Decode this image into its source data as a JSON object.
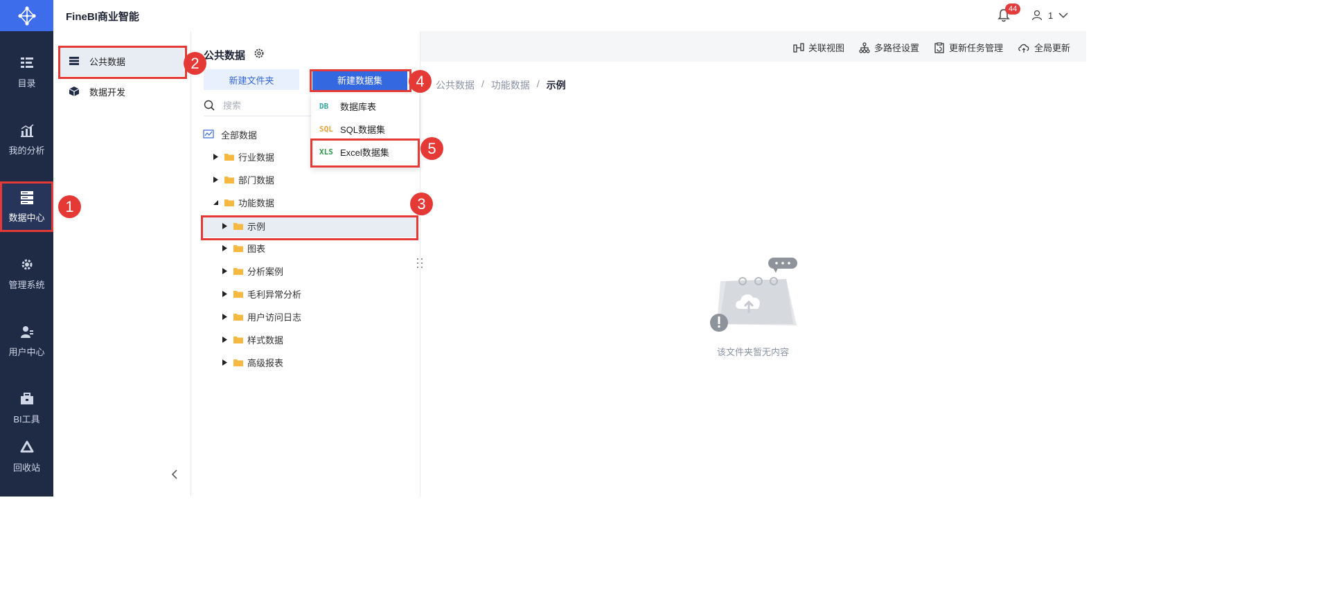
{
  "header": {
    "app_title": "FineBI商业智能",
    "notification_count": "44",
    "user_name": "1"
  },
  "rail": {
    "items": [
      {
        "label": "目录",
        "icon": "catalog-icon"
      },
      {
        "label": "我的分析",
        "icon": "analysis-icon"
      },
      {
        "label": "数据中心",
        "icon": "data-center-icon",
        "active": true
      },
      {
        "label": "管理系统",
        "icon": "gear-icon"
      },
      {
        "label": "用户中心",
        "icon": "user-icon"
      },
      {
        "label": "BI工具",
        "icon": "toolbox-icon"
      },
      {
        "label": "回收站",
        "icon": "recycle-icon"
      }
    ]
  },
  "col2": {
    "items": [
      {
        "label": "公共数据",
        "active": true
      },
      {
        "label": "数据开发"
      }
    ]
  },
  "panel": {
    "title": "公共数据",
    "new_folder": "新建文件夹",
    "new_dataset": "新建数据集",
    "search_placeholder": "搜索",
    "tree": {
      "root": "全部数据",
      "level1": [
        "行业数据",
        "部门数据",
        "功能数据"
      ],
      "level2": [
        "示例",
        "图表",
        "分析案例",
        "毛利异常分析",
        "用户访问日志",
        "样式数据",
        "高级报表"
      ]
    }
  },
  "menu": {
    "items": [
      {
        "label": "数据库表",
        "icon_text": "DB",
        "color": "#3aa6a1"
      },
      {
        "label": "SQL数据集",
        "icon_text": "SQL",
        "color": "#e6a23c"
      },
      {
        "label": "Excel数据集",
        "icon_text": "XLS",
        "color": "#2e9a48"
      }
    ]
  },
  "toolbar": {
    "items": [
      "关联视图",
      "多路径设置",
      "更新任务管理",
      "全局更新"
    ]
  },
  "breadcrumb": {
    "items": [
      "公共数据",
      "功能数据",
      "示例"
    ],
    "separator": "/"
  },
  "empty_state": {
    "message": "该文件夹暂无内容"
  },
  "annotations": [
    "1",
    "2",
    "3",
    "4",
    "5"
  ],
  "colors": {
    "rail_bg": "#1f2a44",
    "accent": "#3468e0",
    "annotation_red": "#e53935"
  }
}
